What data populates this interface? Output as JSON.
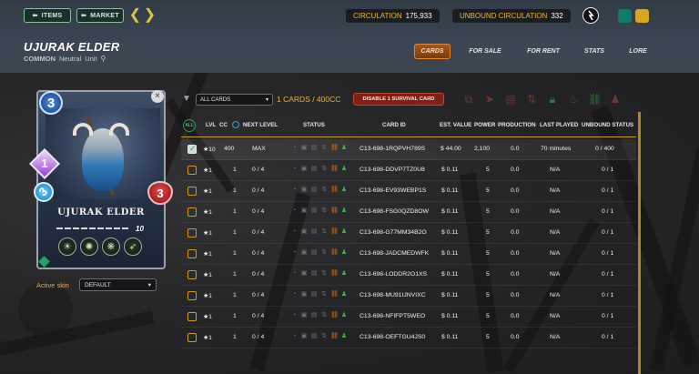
{
  "header": {
    "items_button": "ITEMS",
    "market_button": "MARKET",
    "circulation_label": "CIRCULATION",
    "circulation_value": "175,933",
    "unbound_label": "UNBOUND CIRCULATION",
    "unbound_value": "332"
  },
  "card_title": {
    "name": "UJURAK ELDER",
    "rarity": "COMMON",
    "element": "Neutral",
    "type": "Unit"
  },
  "tabs": [
    "CARDS",
    "FOR SALE",
    "FOR RENT",
    "STATS",
    "LORE"
  ],
  "card": {
    "name": "UJURAK ELDER",
    "mana": "3",
    "speed": "1",
    "armor": "3",
    "health": "3",
    "level": "10",
    "close": "×"
  },
  "skin": {
    "label": "Active skin",
    "value": "DEFAULT"
  },
  "filter": {
    "value": "ALL CARDS",
    "count": "1 CARDS / 400CC",
    "disable_button": "DISABLE 1 SURVIVAL CARD"
  },
  "table": {
    "all_badge": "ALL",
    "headers": {
      "lvl": "LVL",
      "cc": "CC",
      "next_level": "NEXT LEVEL",
      "status": "STATUS",
      "card_id": "CARD ID",
      "est_value": "EST. VALUE",
      "power": "POWER",
      "production": "PRODUCTION",
      "last_played": "LAST PLAYED",
      "unbound_status": "UNBOUND STATUS"
    },
    "rows": [
      {
        "lvl": "★10",
        "cc": "400",
        "next": "MAX",
        "id": "C13-698-1RQPVH789S",
        "value": "$ 44.00",
        "power": "2,100",
        "production": "0.0",
        "last_played": "70 minutes",
        "unbound": "0 / 400"
      },
      {
        "lvl": "★1",
        "cc": "1",
        "next": "0 / 4",
        "id": "C13-698-DDVP7TZ0U8",
        "value": "$ 0.11",
        "power": "5",
        "production": "0.0",
        "last_played": "N/A",
        "unbound": "0 / 1"
      },
      {
        "lvl": "★1",
        "cc": "1",
        "next": "0 / 4",
        "id": "C13-698-EV93WEBP1S",
        "value": "$ 0.11",
        "power": "5",
        "production": "0.0",
        "last_played": "N/A",
        "unbound": "0 / 1"
      },
      {
        "lvl": "★1",
        "cc": "1",
        "next": "0 / 4",
        "id": "C13-698-FSG0QZD8OW",
        "value": "$ 0.11",
        "power": "5",
        "production": "0.0",
        "last_played": "N/A",
        "unbound": "0 / 1"
      },
      {
        "lvl": "★1",
        "cc": "1",
        "next": "0 / 4",
        "id": "C13-698-G77MM34B2O",
        "value": "$ 0.11",
        "power": "5",
        "production": "0.0",
        "last_played": "N/A",
        "unbound": "0 / 1"
      },
      {
        "lvl": "★1",
        "cc": "1",
        "next": "0 / 4",
        "id": "C13-698-JADCMEDWFK",
        "value": "$ 0.11",
        "power": "5",
        "production": "0.0",
        "last_played": "N/A",
        "unbound": "0 / 1"
      },
      {
        "lvl": "★1",
        "cc": "1",
        "next": "0 / 4",
        "id": "C13-698-LODDR2O1XS",
        "value": "$ 0.11",
        "power": "5",
        "production": "0.0",
        "last_played": "N/A",
        "unbound": "0 / 1"
      },
      {
        "lvl": "★1",
        "cc": "1",
        "next": "0 / 4",
        "id": "C13-698-MU91IJNVIXC",
        "value": "$ 0.11",
        "power": "5",
        "production": "0.0",
        "last_played": "N/A",
        "unbound": "0 / 1"
      },
      {
        "lvl": "★1",
        "cc": "1",
        "next": "0 / 4",
        "id": "C13-698-NFIFPT5WEO",
        "value": "$ 0.11",
        "power": "5",
        "production": "0.0",
        "last_played": "N/A",
        "unbound": "0 / 1"
      },
      {
        "lvl": "★1",
        "cc": "1",
        "next": "0 / 4",
        "id": "C13-698-OEFTGU4JS0",
        "value": "$ 0.11",
        "power": "5",
        "production": "0.0",
        "last_played": "N/A",
        "unbound": "0 / 1"
      }
    ]
  },
  "colors": {
    "accent_gold": "#e6b443",
    "active_tab": "#a4571a",
    "disable_button": "#7c2215"
  }
}
